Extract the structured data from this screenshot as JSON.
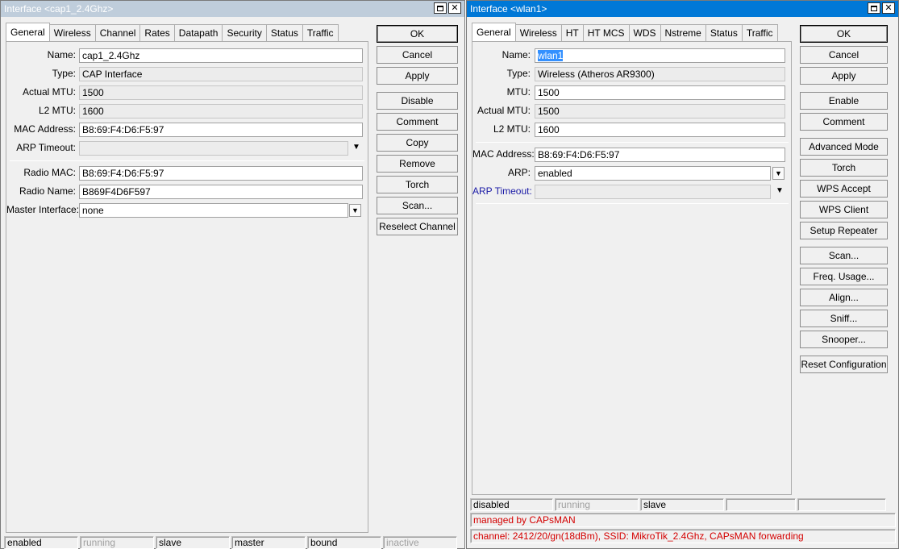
{
  "window_left": {
    "title": "Interface <cap1_2.4Ghz>",
    "tabs": [
      "General",
      "Wireless",
      "Channel",
      "Rates",
      "Datapath",
      "Security",
      "Status",
      "Traffic"
    ],
    "fields": {
      "name": {
        "label": "Name:",
        "value": "cap1_2.4Ghz"
      },
      "type": {
        "label": "Type:",
        "value": "CAP Interface"
      },
      "actual_mtu": {
        "label": "Actual MTU:",
        "value": "1500"
      },
      "l2_mtu": {
        "label": "L2 MTU:",
        "value": "1600"
      },
      "mac_address": {
        "label": "MAC Address:",
        "value": "B8:69:F4:D6:F5:97"
      },
      "arp_timeout": {
        "label": "ARP Timeout:",
        "value": ""
      },
      "radio_mac": {
        "label": "Radio MAC:",
        "value": "B8:69:F4:D6:F5:97"
      },
      "radio_name": {
        "label": "Radio Name:",
        "value": "B869F4D6F597"
      },
      "master_interface": {
        "label": "Master Interface:",
        "value": "none"
      }
    },
    "buttons": [
      "OK",
      "Cancel",
      "Apply",
      "Disable",
      "Comment",
      "Copy",
      "Remove",
      "Torch",
      "Scan...",
      "Reselect Channel"
    ],
    "status": [
      "enabled",
      "running",
      "slave",
      "master",
      "bound",
      "inactive"
    ]
  },
  "window_right": {
    "title": "Interface <wlan1>",
    "tabs": [
      "General",
      "Wireless",
      "HT",
      "HT MCS",
      "WDS",
      "Nstreme",
      "Status",
      "Traffic"
    ],
    "fields": {
      "name": {
        "label": "Name:",
        "value": "wlan1"
      },
      "type": {
        "label": "Type:",
        "value": "Wireless (Atheros AR9300)"
      },
      "mtu": {
        "label": "MTU:",
        "value": "1500"
      },
      "actual_mtu": {
        "label": "Actual MTU:",
        "value": "1500"
      },
      "l2_mtu": {
        "label": "L2 MTU:",
        "value": "1600"
      },
      "mac_address": {
        "label": "MAC Address:",
        "value": "B8:69:F4:D6:F5:97"
      },
      "arp": {
        "label": "ARP:",
        "value": "enabled"
      },
      "arp_timeout": {
        "label": "ARP Timeout:",
        "value": ""
      }
    },
    "buttons": [
      "OK",
      "Cancel",
      "Apply",
      "Enable",
      "Comment",
      "Advanced Mode",
      "Torch",
      "WPS Accept",
      "WPS Client",
      "Setup Repeater",
      "Scan...",
      "Freq. Usage...",
      "Align...",
      "Sniff...",
      "Snooper...",
      "Reset Configuration"
    ],
    "status": [
      "disabled",
      "running",
      "slave",
      "",
      ""
    ],
    "messages": [
      "managed by CAPsMAN",
      "channel: 2412/20/gn(18dBm), SSID: MikroTik_2.4Ghz, CAPsMAN forwarding"
    ]
  },
  "colors": {
    "title_active": "#0078d7",
    "title_inactive": "#bfcddb",
    "message_red": "#d40000",
    "selection": "#3390ff"
  }
}
